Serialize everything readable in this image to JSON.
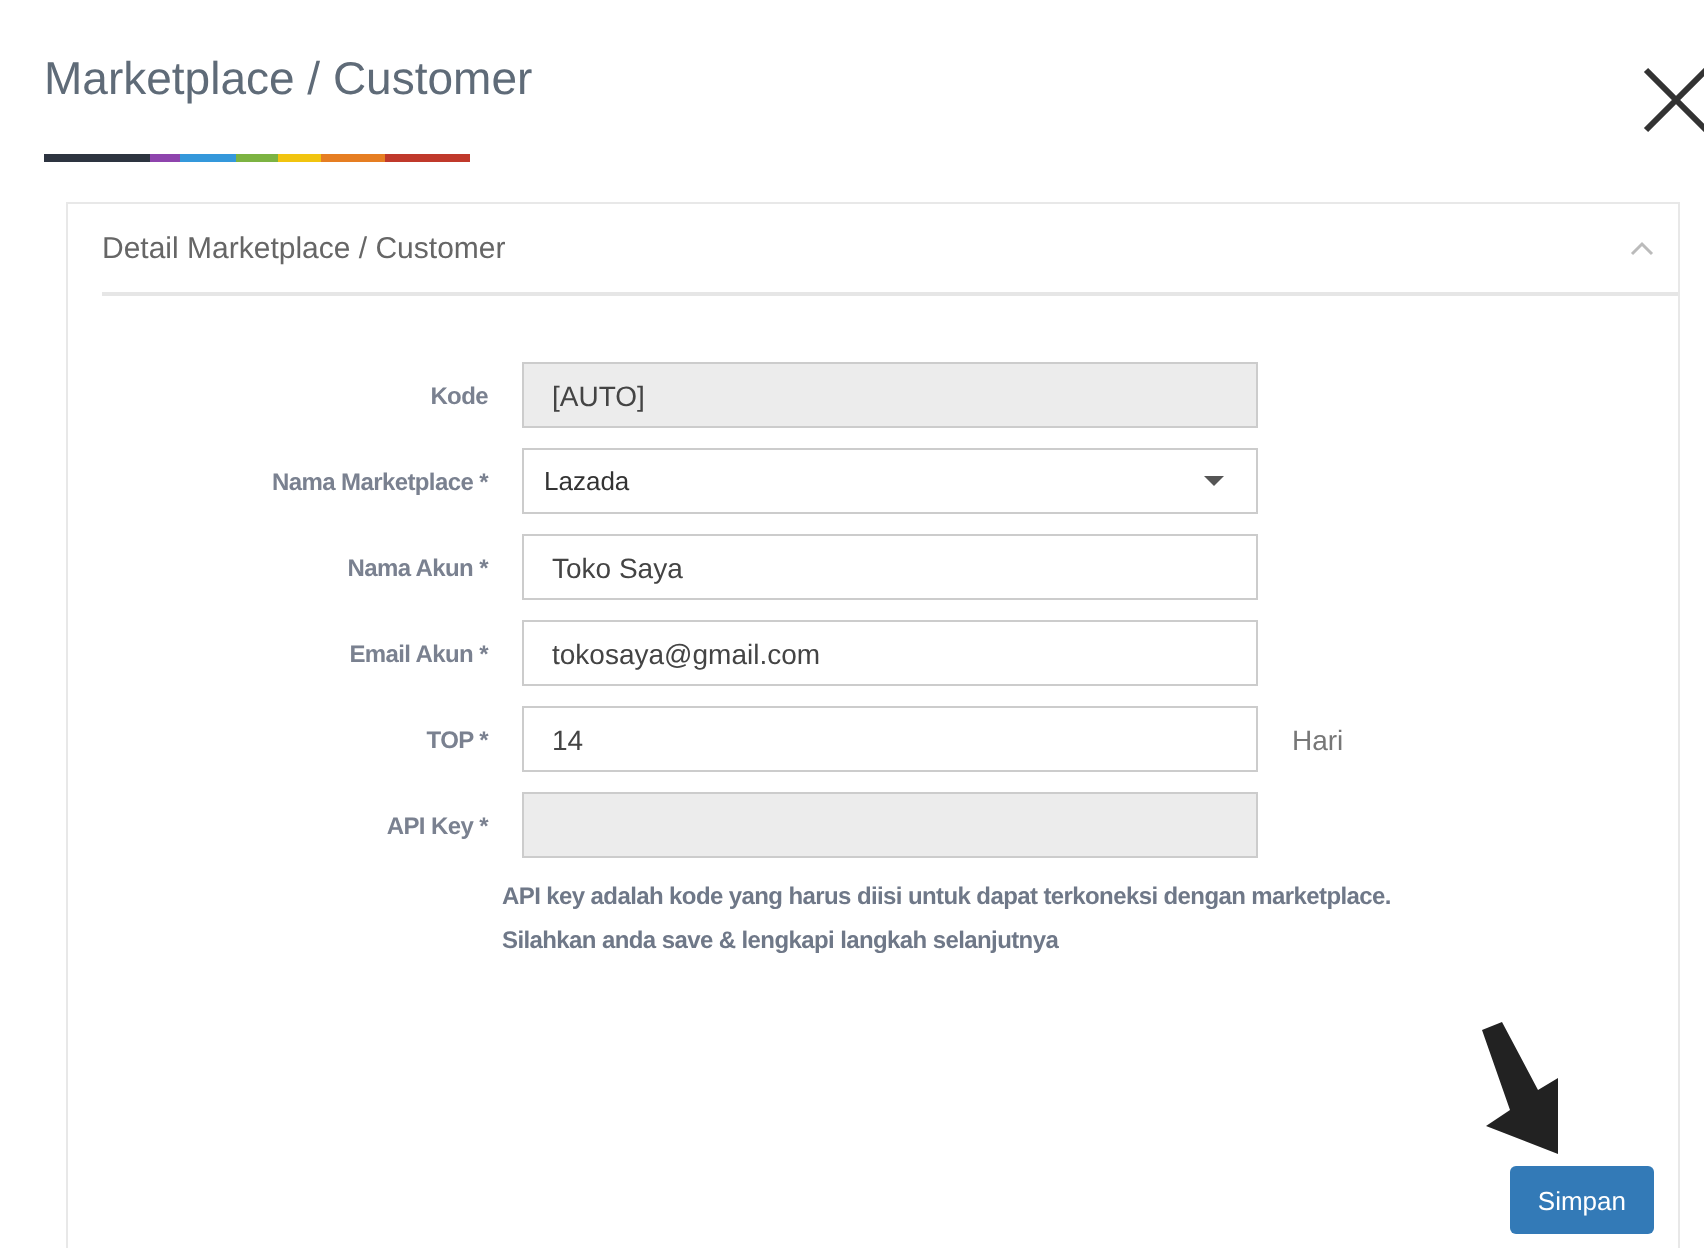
{
  "dialog": {
    "title": "Marketplace / Customer"
  },
  "panel": {
    "title": "Detail Marketplace / Customer",
    "expanded": true
  },
  "fields": [
    {
      "label": "Kode",
      "kind": "text",
      "value": "[AUTO]",
      "disabled": true
    },
    {
      "label": "Nama Marketplace *",
      "kind": "select",
      "value": "Lazada",
      "disabled": false
    },
    {
      "label": "Nama Akun *",
      "kind": "text",
      "value": "Toko Saya",
      "disabled": false
    },
    {
      "label": "Email Akun *",
      "kind": "text",
      "value": "tokosaya@gmail.com",
      "disabled": false
    },
    {
      "label": "TOP *",
      "kind": "text",
      "value": "14",
      "suffix": "Hari",
      "disabled": false
    },
    {
      "label": "API Key *",
      "kind": "text",
      "disabled": true
    }
  ],
  "hints": [
    "API key adalah kode yang harus diisi untuk dapat terkoneksi dengan marketplace.",
    "Silahkan anda save & lengkapi langkah selanjutnya"
  ],
  "buttons": [
    "Simpan"
  ]
}
